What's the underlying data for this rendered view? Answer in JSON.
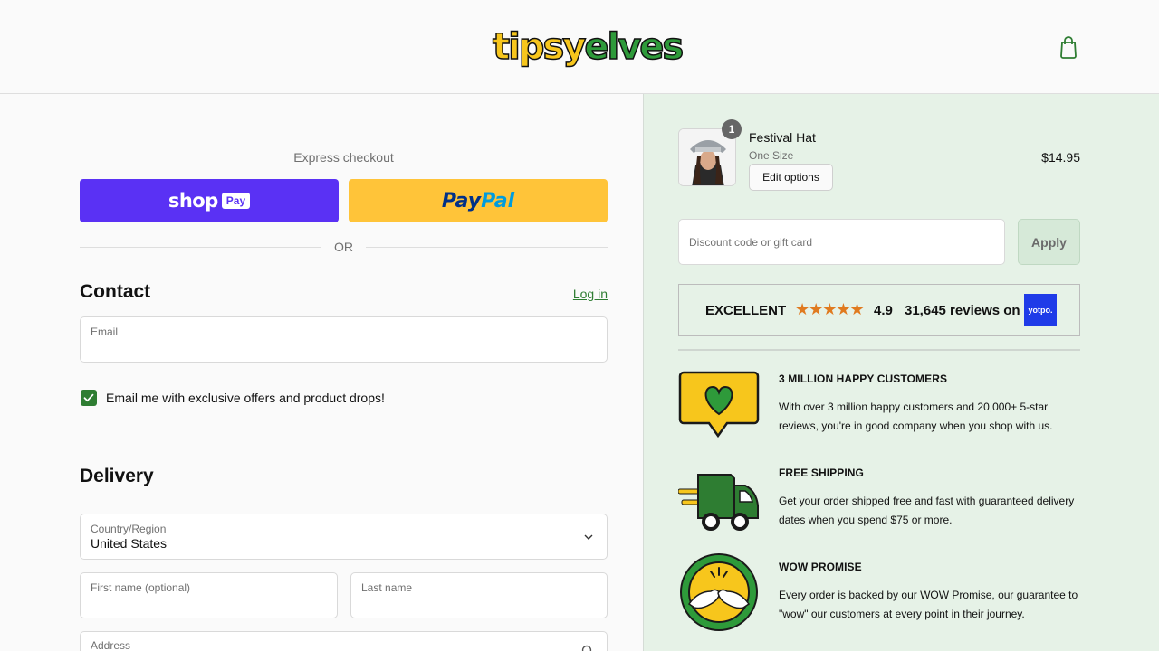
{
  "header": {
    "logo_part1": "tipsy",
    "logo_part2": "elves",
    "cart_icon": "shopping-bag-icon"
  },
  "express": {
    "title": "Express checkout",
    "shop_text": "shop",
    "shop_pay_badge": "Pay",
    "paypal_part1": "Pay",
    "paypal_part2": "Pal",
    "or_label": "OR"
  },
  "contact": {
    "title": "Contact",
    "login_label": "Log in",
    "email_label": "Email",
    "email_value": "",
    "marketing_label": "Email me with exclusive offers and product drops!",
    "marketing_checked": true
  },
  "delivery": {
    "title": "Delivery",
    "country_label": "Country/Region",
    "country_value": "United States",
    "first_name_label": "First name (optional)",
    "last_name_label": "Last name",
    "address_label": "Address"
  },
  "order": {
    "item": {
      "quantity": "1",
      "name": "Festival Hat",
      "variant": "One Size",
      "edit_label": "Edit options",
      "price": "$14.95"
    },
    "discount_placeholder": "Discount code or gift card",
    "apply_label": "Apply"
  },
  "reviews": {
    "label": "EXCELLENT",
    "stars": "★★★★★",
    "rating": "4.9",
    "count_text": "31,645 reviews on",
    "provider": "yotpo."
  },
  "features": [
    {
      "icon": "heart-speech-bubble-icon",
      "title": "3 MILLION HAPPY CUSTOMERS",
      "text": "With over 3 million happy customers and 20,000+ 5-star reviews, you're in good company when you shop with us."
    },
    {
      "icon": "delivery-truck-icon",
      "title": "FREE SHIPPING",
      "text": "Get your order shipped free and fast with guaranteed delivery dates when you spend $75 or more."
    },
    {
      "icon": "pinky-promise-icon",
      "title": "WOW PROMISE",
      "text": "Every order is backed by our WOW Promise, our guarantee to \"wow\" our customers at every point in their journey."
    }
  ],
  "colors": {
    "brand_green": "#2e7d32",
    "shop_pay": "#5a31f4",
    "paypal": "#ffc439",
    "summary_bg": "#e6f2e7"
  }
}
